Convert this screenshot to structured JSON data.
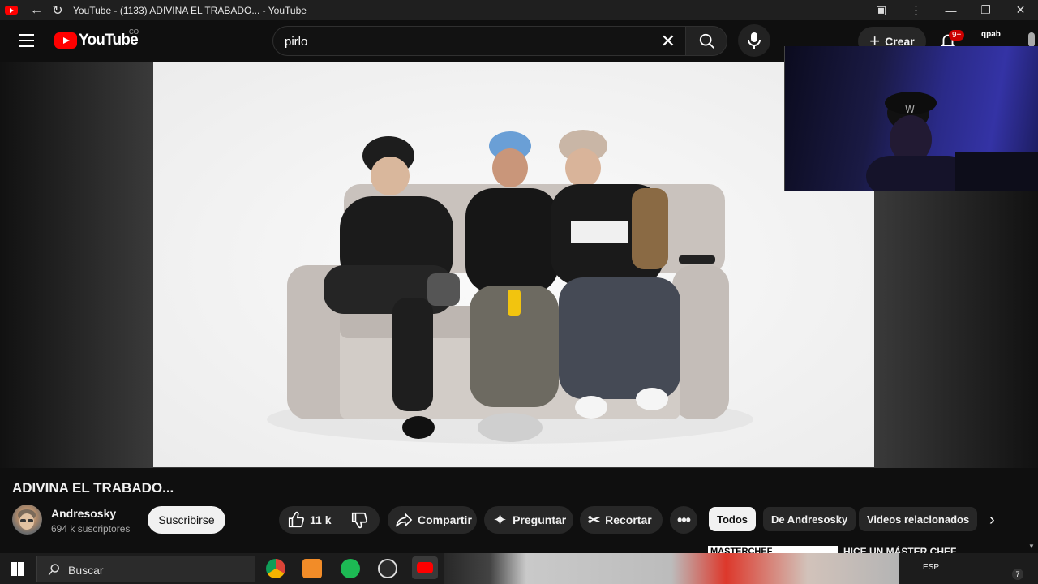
{
  "window": {
    "title": "YouTube - (1133) ADIVINA EL TRABADO... - YouTube",
    "controls": [
      "—",
      "❐",
      "✕"
    ]
  },
  "masthead": {
    "logo_text": "YouTube",
    "region": "CO",
    "search_value": "pirlo",
    "create_label": "Crear",
    "notifications_badge": "9+",
    "account_label": "qpab"
  },
  "video": {
    "title": "ADIVINA EL TRABADO...",
    "channel_name": "Andresosky",
    "subscribers": "694 k suscriptores",
    "subscribe_label": "Suscribirse",
    "likes": "11 k",
    "share_label": "Compartir",
    "ask_label": "Preguntar",
    "clip_label": "Recortar"
  },
  "chips": [
    {
      "label": "Todos",
      "active": true
    },
    {
      "label": "De Andresosky",
      "active": false
    },
    {
      "label": "Videos relacionados",
      "active": false
    }
  ],
  "next_video": {
    "thumb_text": "MASTERCHEF",
    "title": "HICE UN MÁSTER CHEF"
  },
  "taskbar": {
    "search_label": "Buscar",
    "language": "ESP",
    "badge": "7"
  },
  "colors": {
    "brand_red": "#ff0000",
    "background": "#0f0f0f",
    "surface": "#272727"
  }
}
